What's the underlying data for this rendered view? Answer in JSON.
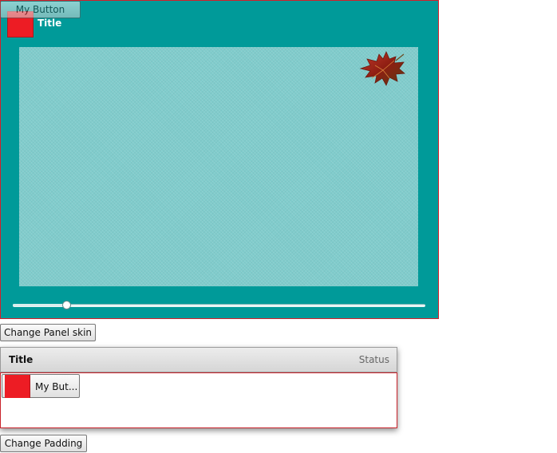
{
  "skin_panel": {
    "title": "Title",
    "status": "",
    "header_swatch_color": "#ed1c24",
    "background_color": "#009a99",
    "content_color": "#80cccc",
    "decoration_icon": "maple-leaf-icon",
    "slider": {
      "value_fraction": 0.13
    }
  },
  "overlay_button": {
    "label": "My Button"
  },
  "change_skin_button": {
    "label": "Change Panel skin"
  },
  "default_panel": {
    "title": "Title",
    "status": "Status",
    "border_color": "#c9232b",
    "button": {
      "label": "My But...",
      "swatch_color": "#ed1c24"
    }
  },
  "change_padding_button": {
    "label": "Change Padding"
  }
}
